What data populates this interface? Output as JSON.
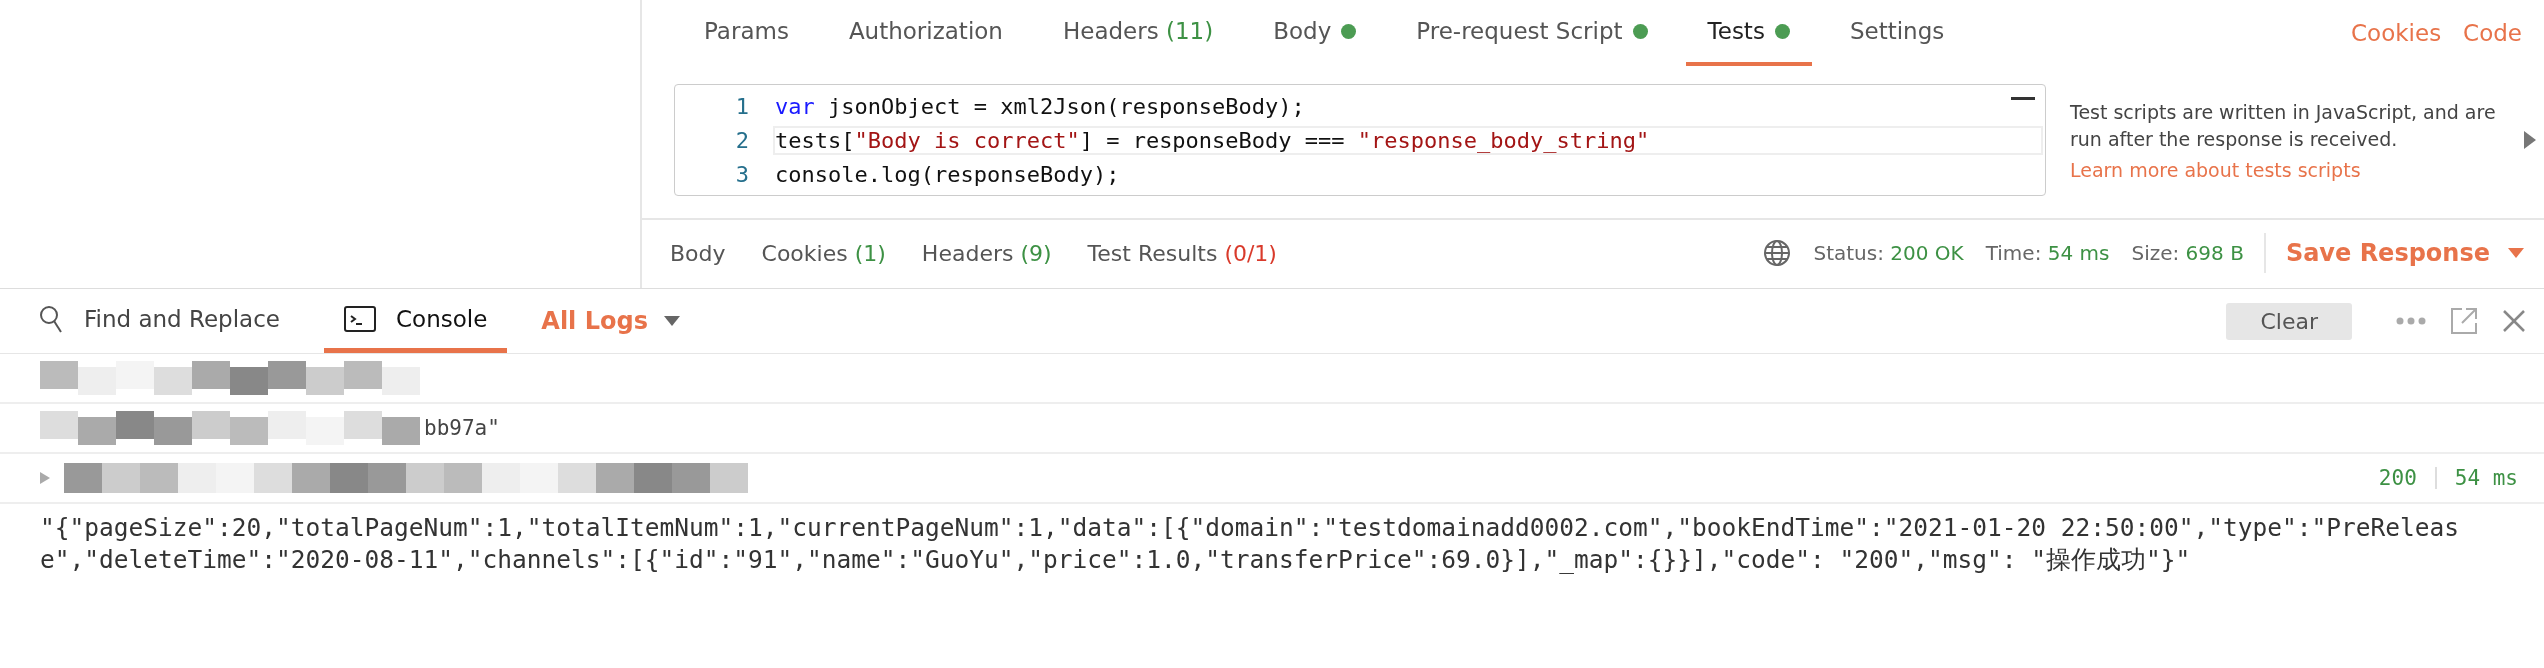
{
  "request_tabs": [
    {
      "label": "Params",
      "dot": false,
      "selected": false
    },
    {
      "label": "Authorization",
      "dot": false,
      "selected": false
    },
    {
      "label": "Headers",
      "count": "(11)",
      "dot": false,
      "selected": false
    },
    {
      "label": "Body",
      "dot": true,
      "selected": false
    },
    {
      "label": "Pre-request Script",
      "dot": true,
      "selected": false
    },
    {
      "label": "Tests",
      "dot": true,
      "selected": true
    },
    {
      "label": "Settings",
      "dot": false,
      "selected": false
    }
  ],
  "header_links": [
    "Cookies",
    "Code"
  ],
  "editor": {
    "lines": [
      {
        "number": "1",
        "tokens": [
          {
            "kind": "keyword",
            "text": "var"
          },
          {
            "kind": "plain",
            "text": " jsonObject = xml2Json(responseBody);"
          }
        ]
      },
      {
        "number": "2",
        "tokens": [
          {
            "kind": "plain",
            "text": "tests["
          },
          {
            "kind": "string",
            "text": "\"Body is correct\""
          },
          {
            "kind": "plain",
            "text": "] = responseBody === "
          },
          {
            "kind": "string",
            "text": "\"response_body_string\""
          }
        ]
      },
      {
        "number": "3",
        "tokens": [
          {
            "kind": "plain",
            "text": "console.log(responseBody);"
          }
        ]
      }
    ]
  },
  "help": {
    "text": "Test scripts are written in JavaScript, and are run after the response is received.",
    "link": "Learn more about tests scripts"
  },
  "response_tabs": [
    {
      "label": "Body"
    },
    {
      "label": "Cookies",
      "count": "(1)",
      "kind": "ok"
    },
    {
      "label": "Headers",
      "count": "(9)",
      "kind": "ok"
    },
    {
      "label": "Test Results",
      "count": "(0/1)",
      "kind": "fail"
    }
  ],
  "response_stats": [
    {
      "label": "Status:",
      "value": "200 OK"
    },
    {
      "label": "Time:",
      "value": "54 ms"
    },
    {
      "label": "Size:",
      "value": "698 B"
    }
  ],
  "save_button": "Save Response",
  "console_tabs": [
    {
      "label": "Find and Replace",
      "kind": "search",
      "selected": false
    },
    {
      "label": "Console",
      "kind": "terminal",
      "selected": true
    }
  ],
  "log_filter": "All Logs",
  "clear_button": "Clear",
  "log_rows": [
    {
      "kind": "redacted"
    },
    {
      "kind": "redacted",
      "fragment": "bb97a\""
    },
    {
      "kind": "request",
      "status": "200",
      "time": "54 ms"
    },
    {
      "kind": "text",
      "fragment": "\"{\"pageSize\":20,\"totalPageNum\":1,\"totalItemNum\":1,\"currentPageNum\":1,\"data\":[{\"domain\":\"testdomainadd0002.com\",\"bookEndTime\":\"2021-01-20 22:50:00\",\"type\":\"PreRelease\",\"deleteTime\":\"2020-08-11\",\"channels\":[{\"id\":\"91\",\"name\":\"GuoYu\",\"price\":1.0,\"transferPrice\":69.0}],\"_map\":{}}],\"code\": \"200\",\"msg\": \"操作成功\"}\""
    }
  ]
}
